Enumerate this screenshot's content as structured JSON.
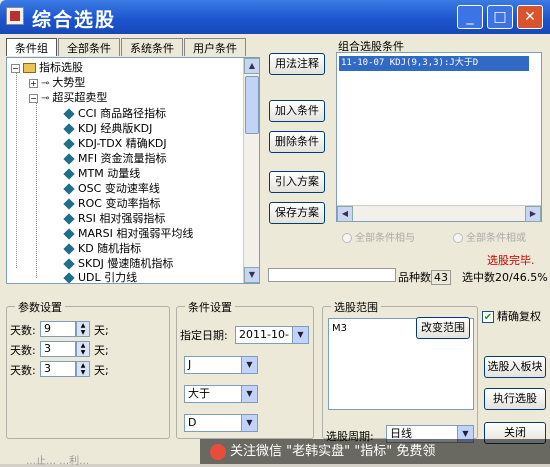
{
  "window": {
    "title": "综合选股",
    "minimize_glyph": "_",
    "maximize_glyph": "□",
    "close_glyph": "✕"
  },
  "tabs": [
    "条件组",
    "全部条件",
    "系统条件",
    "用户条件"
  ],
  "tree": {
    "root": "指标选股",
    "groups": [
      "大势型",
      "超买超卖型"
    ],
    "items": [
      "CCI 商品路径指标",
      "KDJ 经典版KDJ",
      "KDJ-TDX 精确KDJ",
      "MFI 资金流量指标",
      "MTM 动量线",
      "OSC 变动速率线",
      "ROC 变动率指标",
      "RSI 相对强弱指标",
      "MARSI 相对强弱平均线",
      "KD 随机指标",
      "SKDJ 慢速随机指标",
      "UDL 引力线"
    ]
  },
  "middle_buttons": {
    "usage": "用法注释",
    "add": "加入条件",
    "delete": "删除条件",
    "import": "引入方案",
    "save": "保存方案"
  },
  "combo": {
    "label": "组合选股条件",
    "items": [
      "11-10-07 KDJ(9,3,3):J大于D"
    ],
    "radio_all_and": "全部条件相与",
    "radio_all_or": "全部条件相或",
    "status": "选股完毕.",
    "species_label": "品种数",
    "species_value": "43",
    "selected_label": "选中数",
    "selected_value": "20/46.5%"
  },
  "params": {
    "legend": "参数设置",
    "rows": [
      {
        "label": "天数:",
        "value": "9",
        "unit": "天;"
      },
      {
        "label": "天数:",
        "value": "3",
        "unit": "天;"
      },
      {
        "label": "天数:",
        "value": "3",
        "unit": "天;"
      }
    ]
  },
  "conditions": {
    "legend": "条件设置",
    "date_label": "指定日期:",
    "date_value": "2011-10-",
    "line1": "J",
    "operator": "大于",
    "line2": "D"
  },
  "range": {
    "legend": "选股范围",
    "value": "M3",
    "change_button": "改变范围",
    "period_label": "选股周期:",
    "period_value": "日线"
  },
  "right_panel": {
    "exact_rights": "精确复权",
    "to_block": "选股入板块",
    "run": "执行选股",
    "close": "关闭"
  },
  "watermark": {
    "text": "关注微信 \"老韩实盘\" \"指标\" 免费领"
  },
  "footer_faint": "…止…  …利…"
}
